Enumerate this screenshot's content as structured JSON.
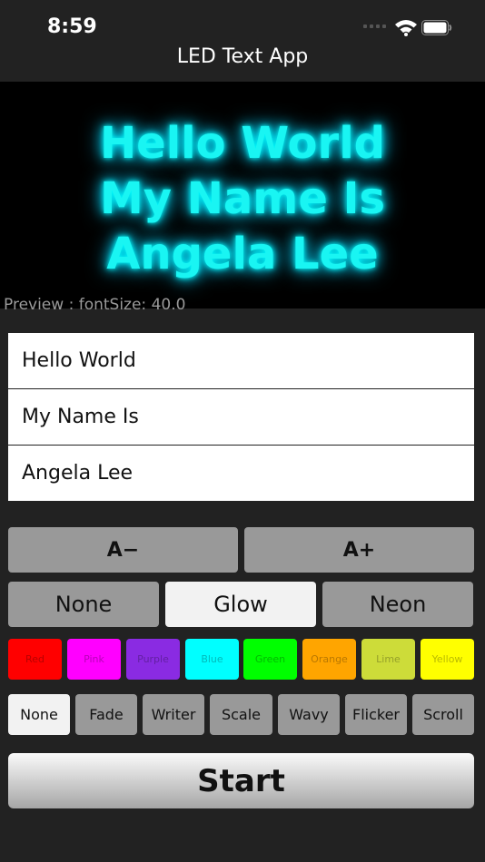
{
  "status_bar": {
    "time": "8:59"
  },
  "nav": {
    "title": "LED Text App"
  },
  "preview": {
    "lines": [
      "Hello World",
      "My Name Is",
      "Angela Lee"
    ],
    "caption": "Preview : fontSize: 40.0",
    "glow_color": "#19f5f3"
  },
  "inputs": [
    "Hello World",
    "My Name Is",
    "Angela Lee"
  ],
  "size_controls": {
    "decrease": "A−",
    "increase": "A+"
  },
  "styles": [
    {
      "label": "None",
      "selected": false
    },
    {
      "label": "Glow",
      "selected": true
    },
    {
      "label": "Neon",
      "selected": false
    }
  ],
  "colors": [
    {
      "label": "Red",
      "hex": "#ff0000"
    },
    {
      "label": "Pink",
      "hex": "#ff00ff"
    },
    {
      "label": "Purple",
      "hex": "#8a2be2"
    },
    {
      "label": "Blue",
      "hex": "#00ffff"
    },
    {
      "label": "Green",
      "hex": "#00ff00"
    },
    {
      "label": "Orange",
      "hex": "#ffa500"
    },
    {
      "label": "Lime",
      "hex": "#cddc39"
    },
    {
      "label": "Yellow",
      "hex": "#ffff00"
    }
  ],
  "animations": [
    {
      "label": "None",
      "selected": true
    },
    {
      "label": "Fade",
      "selected": false
    },
    {
      "label": "Writer",
      "selected": false
    },
    {
      "label": "Scale",
      "selected": false
    },
    {
      "label": "Wavy",
      "selected": false
    },
    {
      "label": "Flicker",
      "selected": false
    },
    {
      "label": "Scroll",
      "selected": false
    }
  ],
  "start_label": "Start"
}
